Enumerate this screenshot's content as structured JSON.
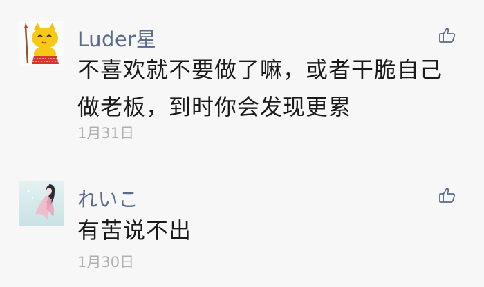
{
  "comments": [
    {
      "author": "Luder星",
      "text": "不喜欢就不要做了嘛，或者干脆自己做老板，到时你会发现更累",
      "date": "1月31日",
      "avatar_icon": "cartoon-cat-avatar-icon",
      "like_icon": "thumbs-up-icon"
    },
    {
      "author": "れいこ",
      "text": "有苦说不出",
      "date": "1月30日",
      "avatar_icon": "anime-girl-avatar-icon",
      "like_icon": "thumbs-up-icon"
    }
  ],
  "colors": {
    "background": "#f7f7f7",
    "author_name": "#5b6b8c",
    "comment_text": "#1a1a1a",
    "date_text": "#b0b0b0",
    "like_icon": "#5b6b8c"
  }
}
